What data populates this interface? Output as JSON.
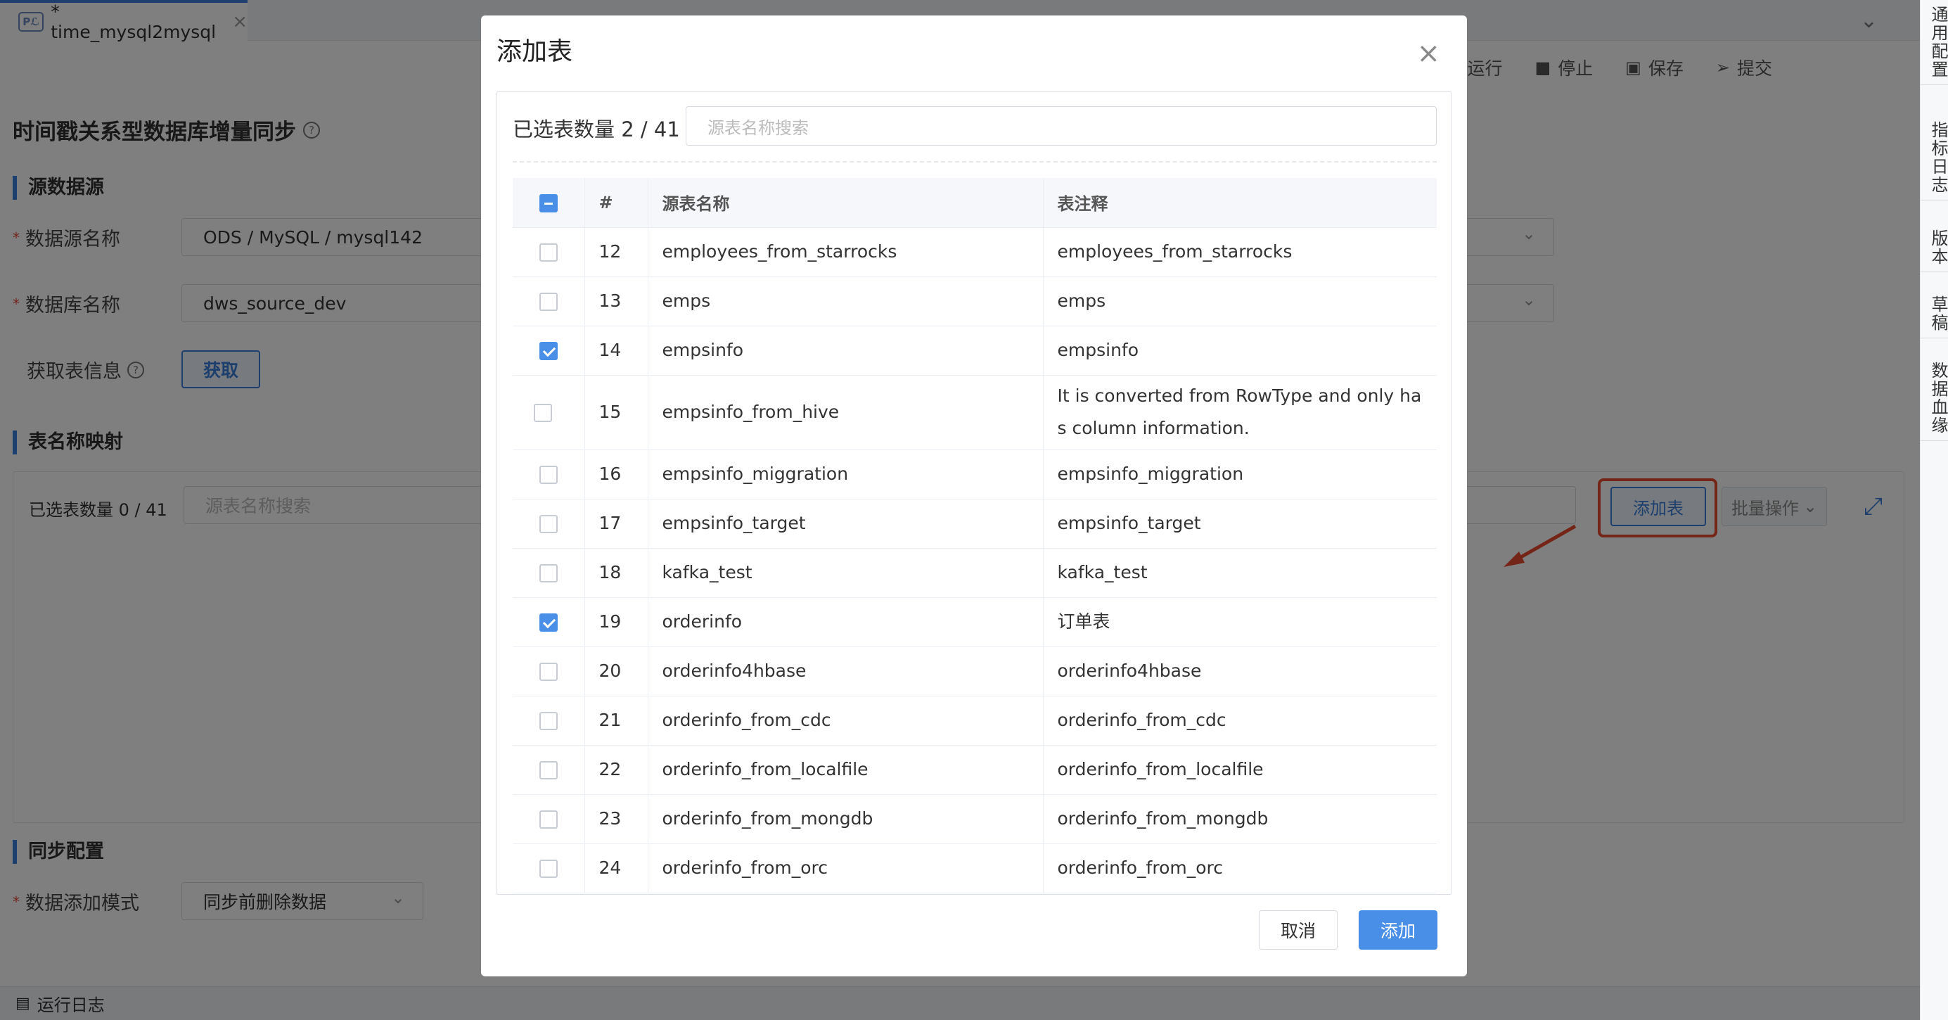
{
  "tab": {
    "icon_text": "Pℒ",
    "title": "* time_mysql2mysql"
  },
  "toolbar": {
    "run": "运行",
    "stop": "停止",
    "save": "保存",
    "submit": "提交"
  },
  "right_rail": [
    "通用配置",
    "指标日志",
    "版本",
    "草稿",
    "数据血缘"
  ],
  "page": {
    "title": "时间戳关系型数据库增量同步",
    "section_source": "源数据源",
    "ds_name_label": "数据源名称",
    "ds_name_value": "ODS / MySQL / mysql142",
    "db_name_label": "数据库名称",
    "db_name_value": "dws_source_dev",
    "fetch_label": "获取表信息",
    "fetch_button": "获取",
    "section_mapping": "表名称映射",
    "mapping_count": "已选表数量 0 / 41",
    "mapping_search_placeholder": "源表名称搜索",
    "add_table_button": "添加表",
    "batch_button": "批量操作",
    "section_sync": "同步配置",
    "sync_mode_label": "数据添加模式",
    "sync_mode_value": "同步前删除数据",
    "run_log": "运行日志"
  },
  "modal": {
    "title": "添加表",
    "selected_count": "已选表数量 2 / 41",
    "search_placeholder": "源表名称搜索",
    "columns": [
      "#",
      "源表名称",
      "表注释"
    ],
    "rows": [
      {
        "num": "12",
        "name": "employees_from_starrocks",
        "comment": "employees_from_starrocks",
        "checked": false
      },
      {
        "num": "13",
        "name": "emps",
        "comment": "emps",
        "checked": false
      },
      {
        "num": "14",
        "name": "empsinfo",
        "comment": "empsinfo",
        "checked": true
      },
      {
        "num": "15",
        "name": "empsinfo_from_hive",
        "comment": "It is converted from RowType and only has column information.",
        "checked": false
      },
      {
        "num": "16",
        "name": "empsinfo_miggration",
        "comment": "empsinfo_miggration",
        "checked": false
      },
      {
        "num": "17",
        "name": "empsinfo_target",
        "comment": "empsinfo_target",
        "checked": false
      },
      {
        "num": "18",
        "name": "kafka_test",
        "comment": "kafka_test",
        "checked": false
      },
      {
        "num": "19",
        "name": "orderinfo",
        "comment": "订单表",
        "checked": true
      },
      {
        "num": "20",
        "name": "orderinfo4hbase",
        "comment": "orderinfo4hbase",
        "checked": false
      },
      {
        "num": "21",
        "name": "orderinfo_from_cdc",
        "comment": "orderinfo_from_cdc",
        "checked": false
      },
      {
        "num": "22",
        "name": "orderinfo_from_localfile",
        "comment": "orderinfo_from_localfile",
        "checked": false
      },
      {
        "num": "23",
        "name": "orderinfo_from_mongdb",
        "comment": "orderinfo_from_mongdb",
        "checked": false
      },
      {
        "num": "24",
        "name": "orderinfo_from_orc",
        "comment": "orderinfo_from_orc",
        "checked": false
      }
    ],
    "cancel_button": "取消",
    "add_button": "添加"
  },
  "colors": {
    "accent": "#3a7fdc",
    "primary_button": "#4a8fe7",
    "highlight": "#e84b2e"
  },
  "icons": [
    "close-icon",
    "play-icon",
    "stop-icon",
    "save-icon",
    "send-icon",
    "help-icon",
    "chevron-down-icon",
    "expand-icon",
    "checkbox-icon",
    "log-icon"
  ]
}
